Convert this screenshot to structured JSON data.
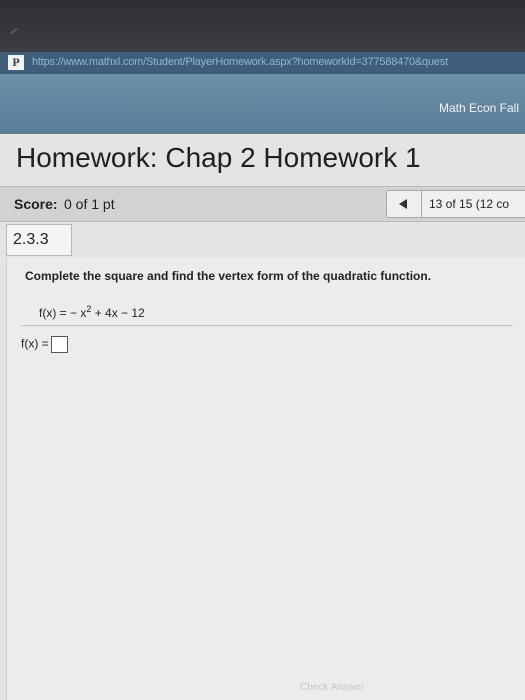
{
  "browser": {
    "url": "https://www.mathxl.com/Student/PlayerHomework.aspx?homeworkId=377588470&quest",
    "site_icon_glyph": "P"
  },
  "course": {
    "name": "Math Econ Fall"
  },
  "homework": {
    "title": "Homework: Chap 2 Homework 1"
  },
  "score": {
    "label": "Score:",
    "value": "0 of 1 pt"
  },
  "navigation": {
    "prev_icon": "left-triangle-icon",
    "progress": "13 of 15 (12 co"
  },
  "question": {
    "section": "2.3.3",
    "instructions": "Complete the square and find the vertex form of the quadratic function.",
    "function_prefix": "f(x) = − x",
    "function_exponent": "2",
    "function_suffix": " + 4x − 12",
    "answer_label": "f(x) ="
  },
  "footer": {
    "faint_button": "Check Answer"
  },
  "colors": {
    "course_bar": "#6e8fa8",
    "url_bar": "#3e5e7a",
    "content_bg": "#e4e4e2"
  }
}
